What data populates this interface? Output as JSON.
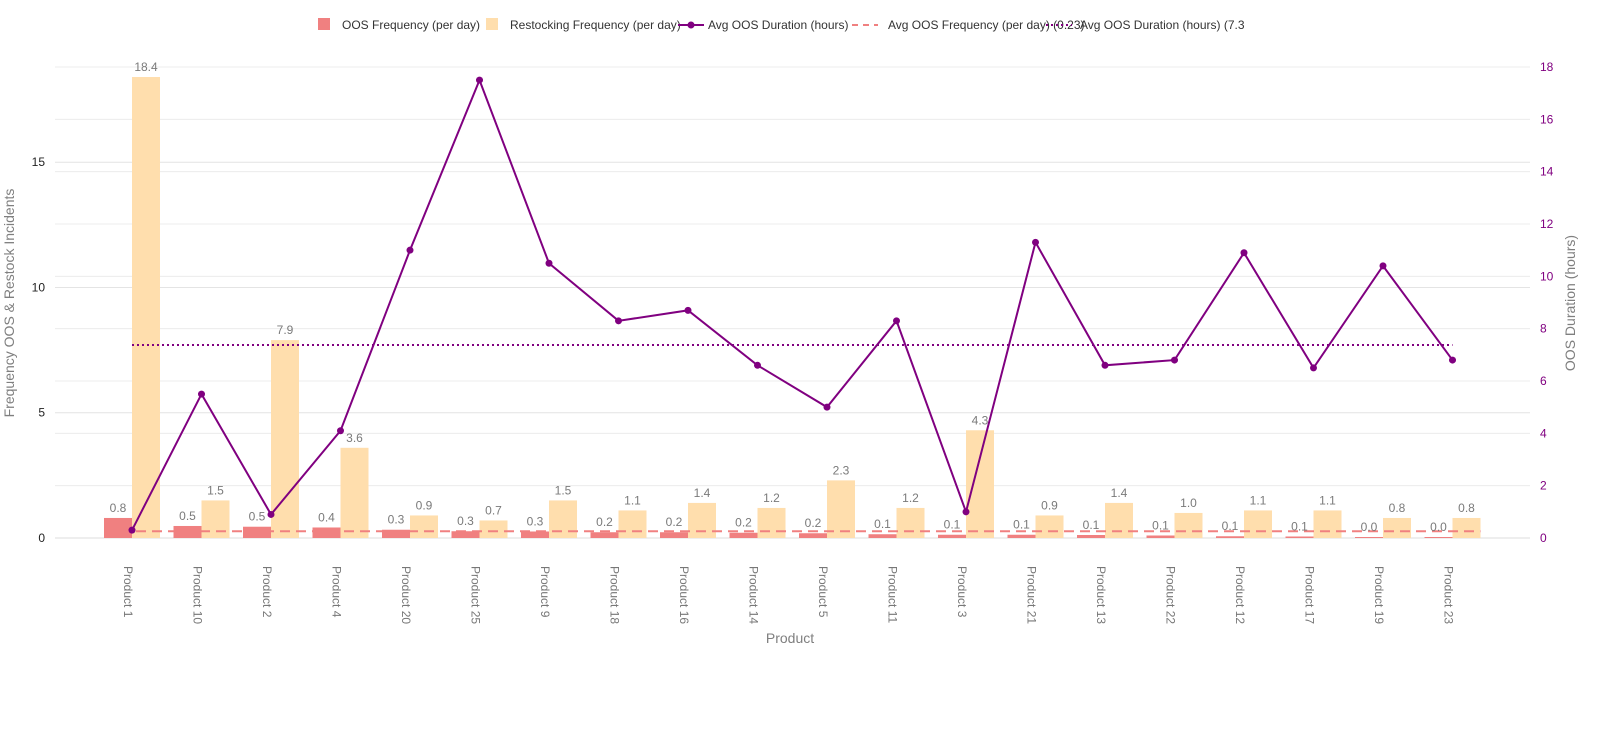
{
  "legend": [
    {
      "key": "oos",
      "label": "OOS Frequency (per day)",
      "kind": "bar",
      "color": "#f08080"
    },
    {
      "key": "restock",
      "label": "Restocking Frequency (per day)",
      "kind": "bar",
      "color": "#ffdead"
    },
    {
      "key": "duration",
      "label": "Avg OOS Duration (hours)",
      "kind": "line",
      "color": "#800080"
    },
    {
      "key": "avg_oos",
      "label": "Avg OOS Frequency (per day) (0.23)",
      "kind": "dash",
      "color": "#f08080"
    },
    {
      "key": "avg_dur",
      "label": "Avg OOS Duration (hours) (7.3",
      "kind": "dot",
      "color": "#800080"
    }
  ],
  "chart_data": {
    "type": "bar",
    "xlabel": "Product",
    "ylabel": "Frequency OOS & Restock Incidents",
    "y2label": "OOS Duration (hours)",
    "categories": [
      "Product 1",
      "Product 10",
      "Product 2",
      "Product 4",
      "Product 20",
      "Product 25",
      "Product 9",
      "Product 18",
      "Product 16",
      "Product 14",
      "Product 5",
      "Product 11",
      "Product 3",
      "Product 21",
      "Product 13",
      "Product 22",
      "Product 12",
      "Product 17",
      "Product 19",
      "Product 23"
    ],
    "ylim": [
      0,
      18.8
    ],
    "y2lim": [
      0,
      18
    ],
    "yticks": [
      0,
      5,
      10,
      15
    ],
    "y2ticks": [
      0,
      2,
      4,
      6,
      8,
      10,
      12,
      14,
      16,
      18
    ],
    "series": [
      {
        "name": "OOS Frequency (per day)",
        "type": "bar",
        "axis": "y",
        "values": [
          0.8,
          0.5,
          0.5,
          0.4,
          0.3,
          0.3,
          0.3,
          0.2,
          0.2,
          0.2,
          0.2,
          0.1,
          0.1,
          0.1,
          0.1,
          0.1,
          0.1,
          0.1,
          0.0,
          0.0
        ],
        "display": [
          0.8,
          0.48,
          0.45,
          0.42,
          0.33,
          0.27,
          0.26,
          0.23,
          0.23,
          0.21,
          0.19,
          0.15,
          0.13,
          0.13,
          0.12,
          0.1,
          0.07,
          0.06,
          0.04,
          0.04
        ]
      },
      {
        "name": "Restocking Frequency (per day)",
        "type": "bar",
        "axis": "y",
        "values": [
          18.4,
          1.5,
          7.9,
          3.6,
          0.9,
          0.7,
          1.5,
          1.1,
          1.4,
          1.2,
          2.3,
          1.2,
          4.3,
          0.9,
          1.4,
          1.0,
          1.1,
          1.1,
          0.8,
          0.8
        ]
      },
      {
        "name": "Avg OOS Duration (hours)",
        "type": "line",
        "axis": "y2",
        "values": [
          0.3,
          5.5,
          0.9,
          4.1,
          11.0,
          17.5,
          10.5,
          8.3,
          8.7,
          6.6,
          5.0,
          8.3,
          1.0,
          11.3,
          6.6,
          6.8,
          10.9,
          6.5,
          10.4,
          6.8
        ]
      },
      {
        "name": "Avg OOS Frequency (per day) (0.23)",
        "type": "hline",
        "axis": "y",
        "value": 0.23
      },
      {
        "name": "Avg OOS Duration (hours) (7.3",
        "type": "hline",
        "axis": "y2",
        "value": 7.3
      }
    ],
    "legend_position": "top",
    "grid": true
  }
}
